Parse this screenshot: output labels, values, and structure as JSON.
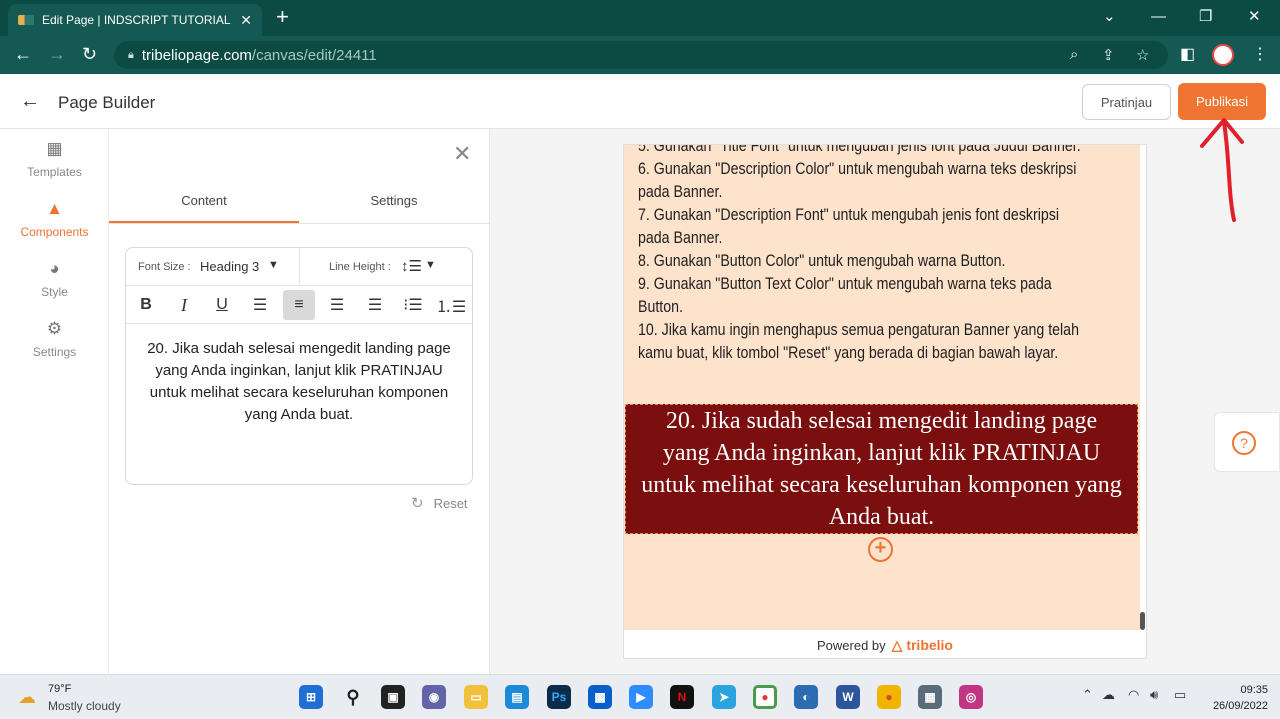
{
  "browser": {
    "tab_title": "Edit Page | INDSCRIPT TUTORIAL",
    "url_host": "tribeliopage.com",
    "url_path": "/canvas/edit/24411"
  },
  "header": {
    "title": "Page Builder",
    "preview_label": "Pratinjau",
    "publish_label": "Publikasi"
  },
  "rail": {
    "items": [
      {
        "label": "Templates",
        "icon": "templates-icon"
      },
      {
        "label": "Components",
        "icon": "components-icon"
      },
      {
        "label": "Style",
        "icon": "palette-icon"
      },
      {
        "label": "Settings",
        "icon": "gear-icon"
      }
    ],
    "active": "Components"
  },
  "panel": {
    "tabs": [
      "Content",
      "Settings"
    ],
    "font_size_label": "Font Size :",
    "font_size_value": "Heading 3",
    "line_height_label": "Line Height :",
    "editor_text": "20. Jika sudah selesai mengedit landing page yang Anda inginkan, lanjut klik PRATINJAU untuk melihat secara keseluruhan komponen yang Anda buat.",
    "reset_label": "Reset",
    "format_buttons": [
      "bold",
      "italic",
      "underline",
      "align-left",
      "align-center",
      "align-right",
      "justify",
      "bullet-list",
      "numbered-list"
    ]
  },
  "canvas": {
    "steps": [
      "5. Gunakan \"Title Font\" untuk mengubah jenis font pada Judul Banner.",
      "6. Gunakan \"Description Color\" untuk mengubah warna teks deskripsi",
      "pada Banner.",
      "7. Gunakan \"Description Font\" untuk mengubah jenis font deskripsi",
      "pada Banner.",
      "8. Gunakan \"Button Color\" untuk mengubah warna Button.",
      "9. Gunakan \"Button Text Color\" untuk mengubah warna teks pada",
      "Button.",
      "10. Jika kamu ingin menghapus semua pengaturan Banner yang telah",
      "kamu buat, klik tombol \"Reset\" yang berada di bagian bawah layar."
    ],
    "heading_text": "20. Jika sudah selesai mengedit landing page yang Anda inginkan, lanjut klik PRATINJAU untuk melihat secara keseluruhan komponen yang Anda buat.",
    "powered_by": "Powered by",
    "brand": "tribelio"
  },
  "taskbar": {
    "temperature": "79°F",
    "weather": "Mostly cloudy",
    "time": "09:35",
    "date": "26/09/2022"
  },
  "colors": {
    "accent": "#f07432",
    "chrome": "#145953",
    "banner_bg": "#7b0e0e",
    "section_bg": "#fde2cc"
  }
}
